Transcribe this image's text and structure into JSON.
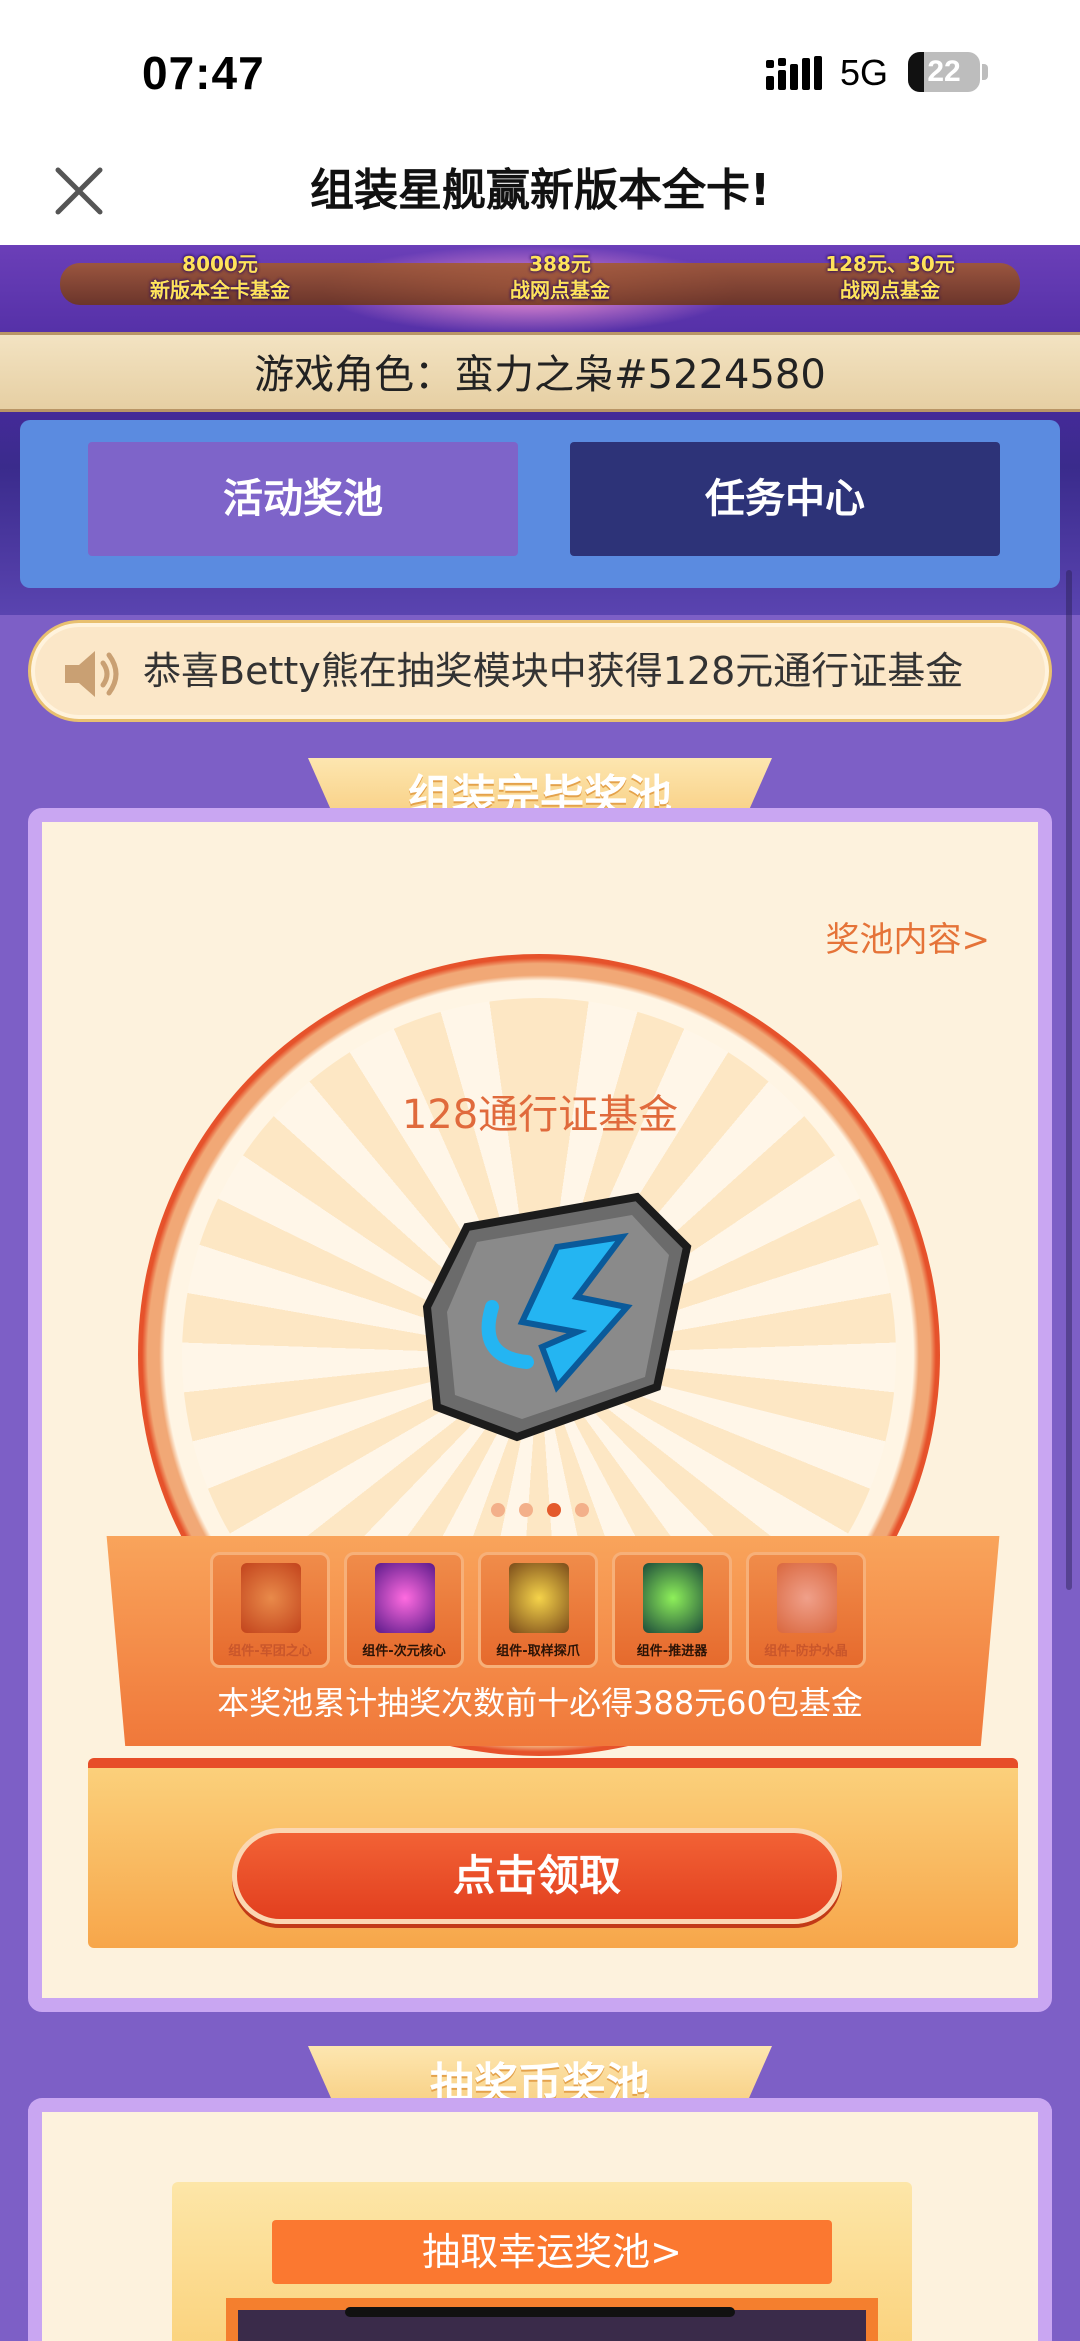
{
  "status_bar": {
    "time": "07:47",
    "network": "5G",
    "battery_percent": 22,
    "battery_label": "22"
  },
  "nav": {
    "title": "组装星舰赢新版本全卡!",
    "close_icon": "close-icon"
  },
  "hero": {
    "funds": [
      {
        "line1": "8000元",
        "line2": "新版本全卡基金"
      },
      {
        "line1": "388元",
        "line2": "战网点基金"
      },
      {
        "line1": "128元、30元",
        "line2": "战网点基金"
      }
    ],
    "role": "游戏角色：蛮力之枭#5224580",
    "tabs": [
      {
        "label": "活动奖池",
        "active": true
      },
      {
        "label": "任务中心",
        "active": false
      }
    ]
  },
  "notice": {
    "icon": "speaker-icon",
    "text": "恭喜Betty熊在抽奖模块中获得128元通行证基金"
  },
  "assembly_pool": {
    "section_title": "组装完毕奖池",
    "pool_link": "奖池内容>",
    "prize_title": "128通行证基金",
    "prize_icon": "rune-stone-icon",
    "carousel": {
      "count": 4,
      "active_index": 2
    },
    "components": [
      {
        "label": "组件-军团之心",
        "collected": false,
        "color": "#d95e2a"
      },
      {
        "label": "组件-次元核心",
        "collected": true,
        "color": "#b23bd6"
      },
      {
        "label": "组件-取样探爪",
        "collected": true,
        "color": "#d9a52a"
      },
      {
        "label": "组件-推进器",
        "collected": true,
        "color": "#3fa63a"
      },
      {
        "label": "组件-防护水晶",
        "collected": false,
        "color": "#e07a5a"
      }
    ],
    "note": "本奖池累计抽奖次数前十必得388元60包基金",
    "claim_button": "点击领取"
  },
  "lottery_pool": {
    "section_title": "抽奖币奖池",
    "lucky_button": "抽取幸运奖池>"
  },
  "colors": {
    "accent": "#e45a2c",
    "panel_border": "#c9a6f2",
    "page_bg": "#7d5fc6",
    "tab_active": "#7e64c9",
    "tab_inactive": "#2d3378"
  }
}
